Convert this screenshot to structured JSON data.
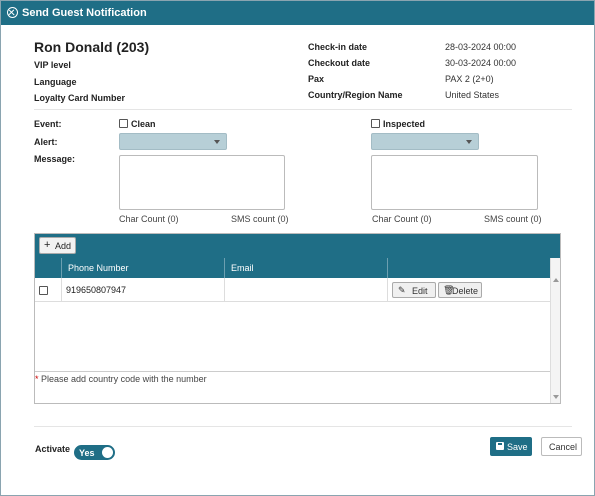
{
  "dialog": {
    "title": "Send Guest Notification"
  },
  "guest": {
    "name": "Ron Donald (203)",
    "vip_label": "VIP level",
    "language_label": "Language",
    "loyalty_label": "Loyalty Card Number"
  },
  "stay": {
    "checkin_label": "Check-in date",
    "checkin_value": "28-03-2024 00:00",
    "checkout_label": "Checkout date",
    "checkout_value": "30-03-2024 00:00",
    "pax_label": "Pax",
    "pax_value": "PAX 2 (2+0)",
    "country_label": "Country/Region Name",
    "country_value": "United States"
  },
  "form": {
    "event_label": "Event:",
    "alert_label": "Alert:",
    "message_label": "Message:",
    "left": {
      "checkbox_label": "Clean",
      "checked": false,
      "char_count": "Char Count (0)",
      "sms_count": "SMS count (0)"
    },
    "right": {
      "checkbox_label": "Inspected",
      "checked": false,
      "char_count": "Char Count (0)",
      "sms_count": "SMS count (0)"
    }
  },
  "grid": {
    "add_label": "Add",
    "columns": [
      "Phone Number",
      "Email"
    ],
    "rows": [
      {
        "phone": "919650807947",
        "email": "",
        "edit_label": "Edit",
        "delete_label": "Delete"
      }
    ],
    "note_star": "*",
    "note": "Please add country code with the number"
  },
  "footer": {
    "activate_label": "Activate",
    "toggle_label": "Yes",
    "toggle_on": true,
    "save_label": "Save",
    "cancel_label": "Cancel"
  },
  "colors": {
    "accent": "#1f6e86",
    "select_fill": "#b7cfd7"
  },
  "icons": {
    "title": "close-circle-icon",
    "add": "plus-icon",
    "edit": "pencil-icon",
    "delete": "trash-icon",
    "save": "floppy-disk-icon"
  }
}
